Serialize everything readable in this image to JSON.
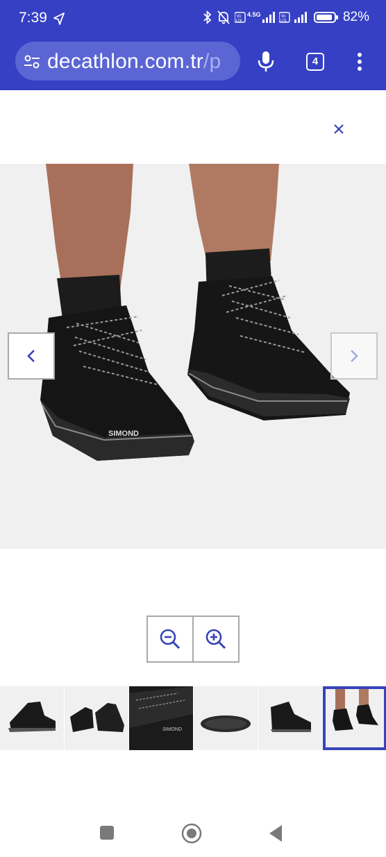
{
  "status_bar": {
    "time": "7:39",
    "network": "4.5G",
    "battery": "82%"
  },
  "browser": {
    "url_host": "decathlon.com.tr",
    "url_rest": "/p",
    "tab_count": "4"
  },
  "viewer": {
    "close_icon": "close-icon",
    "prev_icon": "chevron-left-icon",
    "next_icon": "chevron-right-icon",
    "zoom_out_icon": "zoom-out-icon",
    "zoom_in_icon": "zoom-in-icon",
    "thumbnail_count": 6,
    "selected_thumbnail": 6,
    "brand_on_boot": "SIMOND"
  },
  "colors": {
    "brand_blue": "#3643ba",
    "chrome_blue": "#3640c4"
  }
}
